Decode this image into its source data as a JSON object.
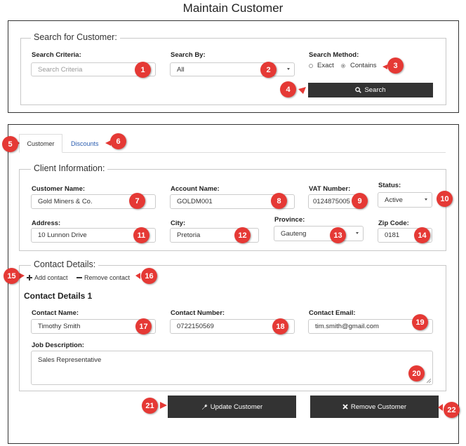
{
  "page": {
    "title": "Maintain Customer"
  },
  "search": {
    "legend": "Search for Customer:",
    "criteria_label": "Search Criteria:",
    "criteria_placeholder": "Search Criteria",
    "by_label": "Search By:",
    "by_value": "All",
    "method_label": "Search Method:",
    "method_options": [
      {
        "label": "Exact",
        "selected": false
      },
      {
        "label": "Contains",
        "selected": true
      }
    ],
    "button_label": "Search",
    "button_icon": "search-icon"
  },
  "tabs": [
    {
      "label": "Customer",
      "active": true
    },
    {
      "label": "Discounts",
      "active": false
    }
  ],
  "client": {
    "legend": "Client Information:",
    "customer_name_label": "Customer Name:",
    "customer_name": "Gold Miners & Co.",
    "account_name_label": "Account Name:",
    "account_name": "GOLDM001",
    "vat_label": "VAT Number:",
    "vat": "0124875005",
    "status_label": "Status:",
    "status": "Active",
    "address_label": "Address:",
    "address": "10 Lunnon Drive",
    "city_label": "City:",
    "city": "Pretoria",
    "province_label": "Province:",
    "province": "Gauteng",
    "zip_label": "Zip Code:",
    "zip": "0181"
  },
  "contact": {
    "legend": "Contact Details:",
    "add_label": "Add contact",
    "remove_label": "Remove contact",
    "heading": "Contact Details 1",
    "name_label": "Contact Name:",
    "name": "Timothy Smith",
    "number_label": "Contact Number:",
    "number": "0722150569",
    "email_label": "Contact Email:",
    "email": "tim.smith@gmail.com",
    "job_label": "Job Description:",
    "job": "Sales Representative"
  },
  "actions": {
    "update_label": "Update Customer",
    "update_icon": "wrench-icon",
    "remove_label": "Remove Customer",
    "remove_icon": "close-icon"
  },
  "badges": [
    "1",
    "2",
    "3",
    "4",
    "5",
    "6",
    "7",
    "8",
    "9",
    "10",
    "11",
    "12",
    "13",
    "14",
    "15",
    "16",
    "17",
    "18",
    "19",
    "20",
    "21",
    "22"
  ],
  "colors": {
    "badge": "#e53935",
    "button": "#333333",
    "link": "#2a5db0"
  }
}
